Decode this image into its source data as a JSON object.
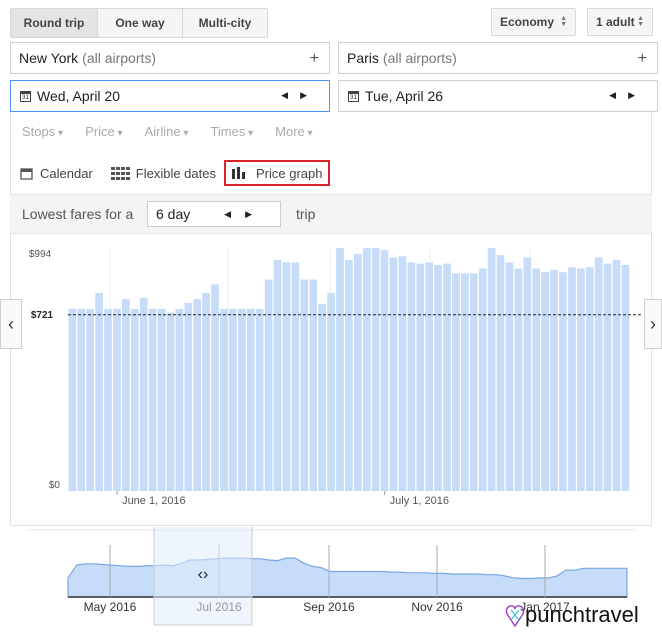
{
  "trip_types": [
    {
      "label": "Round trip",
      "active": true
    },
    {
      "label": "One way",
      "active": false
    },
    {
      "label": "Multi-city",
      "active": false
    }
  ],
  "cabin": {
    "label": "Economy"
  },
  "passengers": {
    "label": "1 adult"
  },
  "origin": {
    "city": "New York",
    "qualifier": "(all airports)"
  },
  "destination": {
    "city": "Paris",
    "qualifier": "(all airports)"
  },
  "depart_date": "Wed, April 20",
  "return_date": "Tue, April 26",
  "calendar_glyph": "31",
  "filters": [
    "Stops",
    "Price",
    "Airline",
    "Times",
    "More"
  ],
  "views": {
    "calendar": "Calendar",
    "flexible": "Flexible dates",
    "graph": "Price graph"
  },
  "lowest_fares": {
    "prefix": "Lowest fares for a",
    "duration": "6 day",
    "suffix": "trip"
  },
  "colors": {
    "bar": "#c6dcf8",
    "highlight": "#d9232a",
    "accent_border": "#4d90fe"
  },
  "chart_data": {
    "type": "bar",
    "y_ticks": [
      "$994",
      "$721",
      "$0"
    ],
    "reference_line": {
      "value": 721,
      "label": "$721"
    },
    "x_ticks": [
      {
        "label": "June 1, 2016",
        "index": 5
      },
      {
        "label": "July 1, 2016",
        "index": 35
      }
    ],
    "ylim": [
      0,
      994
    ],
    "values": [
      745,
      745,
      745,
      810,
      745,
      745,
      785,
      745,
      790,
      745,
      745,
      730,
      745,
      770,
      785,
      810,
      845,
      745,
      745,
      745,
      745,
      745,
      865,
      945,
      935,
      935,
      865,
      865,
      765,
      810,
      994,
      945,
      970,
      994,
      994,
      985,
      955,
      960,
      935,
      930,
      935,
      925,
      930,
      890,
      890,
      890,
      910,
      994,
      965,
      935,
      910,
      955,
      910,
      895,
      905,
      895,
      915,
      910,
      915,
      955,
      930,
      945,
      925
    ],
    "overview": {
      "type": "area",
      "months": [
        "May 2016",
        "Jul 2016",
        "Sep 2016",
        "Nov 2016",
        "Jan 2017"
      ],
      "values": [
        0.3,
        0.5,
        0.52,
        0.52,
        0.51,
        0.5,
        0.49,
        0.48,
        0.48,
        0.49,
        0.49,
        0.5,
        0.49,
        0.53,
        0.58,
        0.58,
        0.59,
        0.6,
        0.61,
        0.61,
        0.61,
        0.6,
        0.6,
        0.58,
        0.57,
        0.61,
        0.61,
        0.53,
        0.48,
        0.46,
        0.4,
        0.4,
        0.4,
        0.4,
        0.4,
        0.4,
        0.4,
        0.39,
        0.39,
        0.38,
        0.38,
        0.38,
        0.37,
        0.37,
        0.36,
        0.36,
        0.36,
        0.36,
        0.35,
        0.35,
        0.33,
        0.3,
        0.29,
        0.29,
        0.3,
        0.3,
        0.33,
        0.42,
        0.42,
        0.45,
        0.45,
        0.45,
        0.45,
        0.45,
        0.45
      ]
    }
  },
  "watermark": {
    "brand": "punchtravel",
    "brand_a": "punch",
    "brand_b": "travel"
  }
}
